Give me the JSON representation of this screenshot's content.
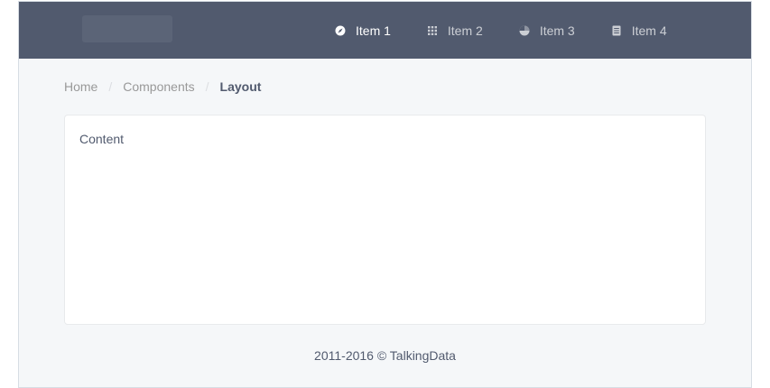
{
  "colors": {
    "header_bg": "#515a6e",
    "page_bg": "#f5f7f9",
    "content_bg": "#ffffff",
    "text": "#515a6e",
    "muted_text": "#999999"
  },
  "header": {
    "logo_icon": "logo-placeholder",
    "nav": [
      {
        "label": "Item 1",
        "icon": "navigate-icon",
        "active": true
      },
      {
        "label": "Item 2",
        "icon": "grid-icon",
        "active": false
      },
      {
        "label": "Item 3",
        "icon": "pie-chart-icon",
        "active": false
      },
      {
        "label": "Item 4",
        "icon": "document-icon",
        "active": false
      }
    ]
  },
  "breadcrumb": {
    "items": [
      "Home",
      "Components",
      "Layout"
    ],
    "separator": "/"
  },
  "content": {
    "text": "Content"
  },
  "footer": {
    "text": "2011-2016 © TalkingData"
  }
}
